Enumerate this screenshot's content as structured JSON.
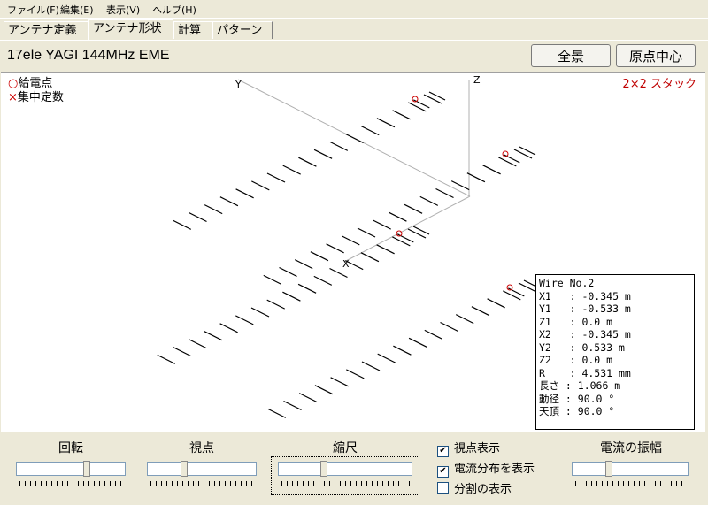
{
  "menu": [
    "ファイル(F)",
    "編集(E)",
    "表示(V)",
    "ヘルプ(H)"
  ],
  "tabs": [
    "アンテナ定義",
    "アンテナ形状",
    "計算",
    "パターン"
  ],
  "active_tab": "アンテナ形状",
  "antenna_title": "17ele YAGI 144MHz EME",
  "buttons": {
    "full_view": "全景",
    "origin_center": "原点中心"
  },
  "legend": {
    "feed_point_mark": "○",
    "feed_point": "給電点",
    "lumped_mark": "×",
    "lumped": "集中定数"
  },
  "stack_label": "2×2 スタック",
  "axes": {
    "x": "X",
    "y": "Y",
    "z": "Z"
  },
  "wire_info": {
    "title": "Wire No.2",
    "rows": [
      "X1   : -0.345 m",
      "Y1   : -0.533 m",
      "Z1   : 0.0 m",
      "X2   : -0.345 m",
      "Y2   : 0.533 m",
      "Z2   : 0.0 m",
      "R    : 4.531 mm",
      "長さ : 1.066 m",
      "動径 : 90.0 °",
      "天頂 : 90.0 °"
    ]
  },
  "controls": {
    "rotate": "回転",
    "viewpoint": "視点",
    "scale": "縮尺",
    "current_amplitude": "電流の振幅"
  },
  "checkboxes": [
    {
      "label": "視点表示",
      "checked": true
    },
    {
      "label": "電流分布を表示",
      "checked": true
    },
    {
      "label": "分割の表示",
      "checked": false
    }
  ],
  "colors": {
    "feed": "#cc0000",
    "axis": "#b0b0b0",
    "stack": "#c00000"
  }
}
